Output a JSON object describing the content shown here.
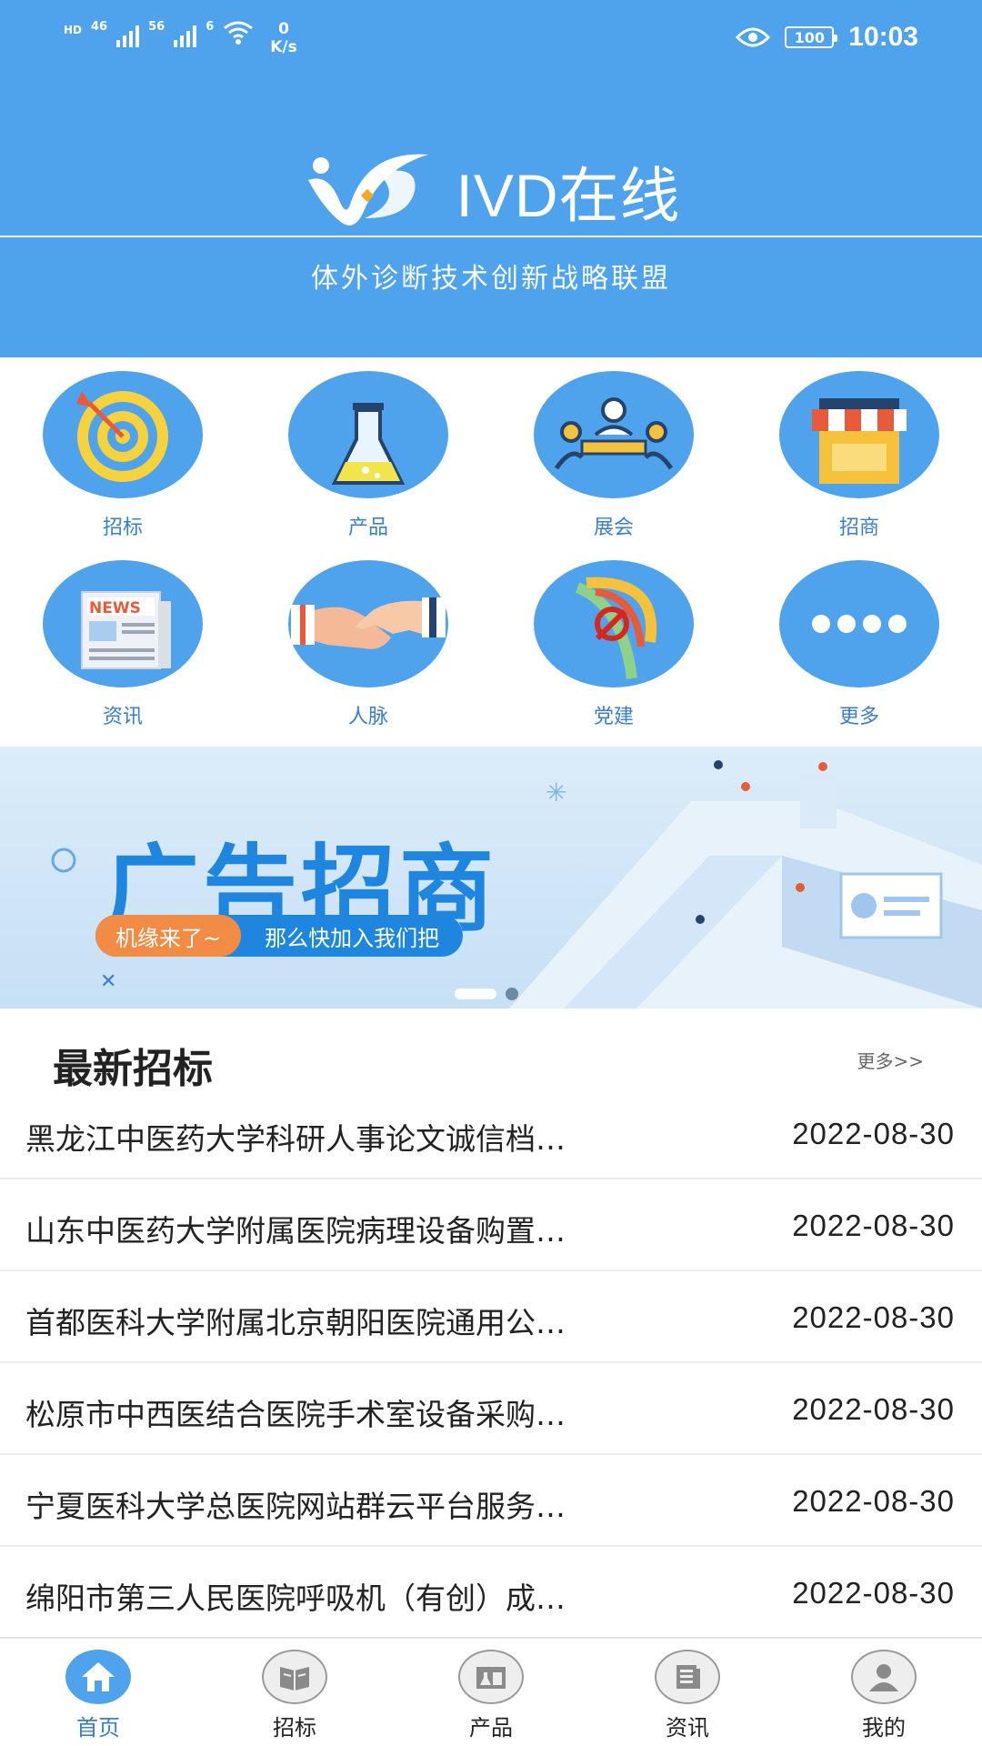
{
  "status_bar": {
    "left_labels": [
      "HD",
      "46",
      "56",
      "6"
    ],
    "net_speed_value": "0",
    "net_speed_unit": "K/s",
    "battery": "100",
    "time": "10:03"
  },
  "header": {
    "brand_name": "IVD在线",
    "slogan": "体外诊断技术创新战略联盟",
    "bg_color": "#4fa3ec"
  },
  "menu": {
    "items": [
      {
        "label": "招标",
        "icon": "target-icon"
      },
      {
        "label": "产品",
        "icon": "flask-icon"
      },
      {
        "label": "展会",
        "icon": "meeting-icon"
      },
      {
        "label": "招商",
        "icon": "shop-icon"
      },
      {
        "label": "资讯",
        "icon": "news-icon"
      },
      {
        "label": "人脉",
        "icon": "handshake-icon"
      },
      {
        "label": "党建",
        "icon": "party-emblem-icon"
      },
      {
        "label": "更多",
        "icon": "more-icon"
      }
    ]
  },
  "banner": {
    "title": "广告招商",
    "tag": "机缘来了~",
    "subtitle": "那么快加入我们把"
  },
  "section": {
    "title": "最新招标",
    "more": "更多>>"
  },
  "tenders": [
    {
      "title": "黑龙江中医药大学科研人事论文诚信档…",
      "date": "2022-08-30"
    },
    {
      "title": "山东中医药大学附属医院病理设备购置…",
      "date": "2022-08-30"
    },
    {
      "title": "首都医科大学附属北京朝阳医院通用公…",
      "date": "2022-08-30"
    },
    {
      "title": "松原市中西医结合医院手术室设备采购…",
      "date": "2022-08-30"
    },
    {
      "title": "宁夏医科大学总医院网站群云平台服务…",
      "date": "2022-08-30"
    },
    {
      "title": "绵阳市第三人民医院呼吸机（有创）成…",
      "date": "2022-08-30"
    }
  ],
  "tabbar": {
    "tabs": [
      {
        "label": "首页",
        "icon": "home-icon",
        "active": true
      },
      {
        "label": "招标",
        "icon": "book-icon",
        "active": false
      },
      {
        "label": "产品",
        "icon": "product-icon",
        "active": false
      },
      {
        "label": "资讯",
        "icon": "news-doc-icon",
        "active": false
      },
      {
        "label": "我的",
        "icon": "user-icon",
        "active": false
      }
    ]
  }
}
